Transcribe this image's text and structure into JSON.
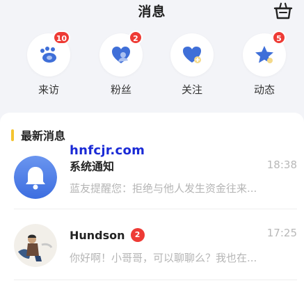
{
  "header": {
    "title": "消息",
    "right_icon": "basket-icon"
  },
  "categories": [
    {
      "label": "来访",
      "badge": "10",
      "icon": "footprint-icon",
      "color": "#3f6fd8"
    },
    {
      "label": "粉丝",
      "badge": "2",
      "icon": "heart-person-icon",
      "color": "#3f6fd8"
    },
    {
      "label": "关注",
      "badge": "",
      "icon": "heart-plus-icon",
      "color": "#3f6fd8"
    },
    {
      "label": "动态",
      "badge": "5",
      "icon": "star-icon",
      "color": "#3f6fd8"
    }
  ],
  "section": {
    "title": "最新消息",
    "accent_color": "#f4c430"
  },
  "watermark": "hnfcjr.com",
  "messages": [
    {
      "name": "系统通知",
      "time": "18:38",
      "preview": "蓝友提醒您：拒绝与他人发生资金往来...",
      "badge": "",
      "avatar": "bell-icon"
    },
    {
      "name": "Hundson",
      "time": "17:25",
      "preview": "你好啊！小哥哥，可以聊聊么？我也在...",
      "badge": "2",
      "avatar": "user-photo"
    }
  ],
  "colors": {
    "badge_red": "#ee3b35",
    "icon_blue": "#3f6fd8",
    "background": "#f3f4f8"
  }
}
